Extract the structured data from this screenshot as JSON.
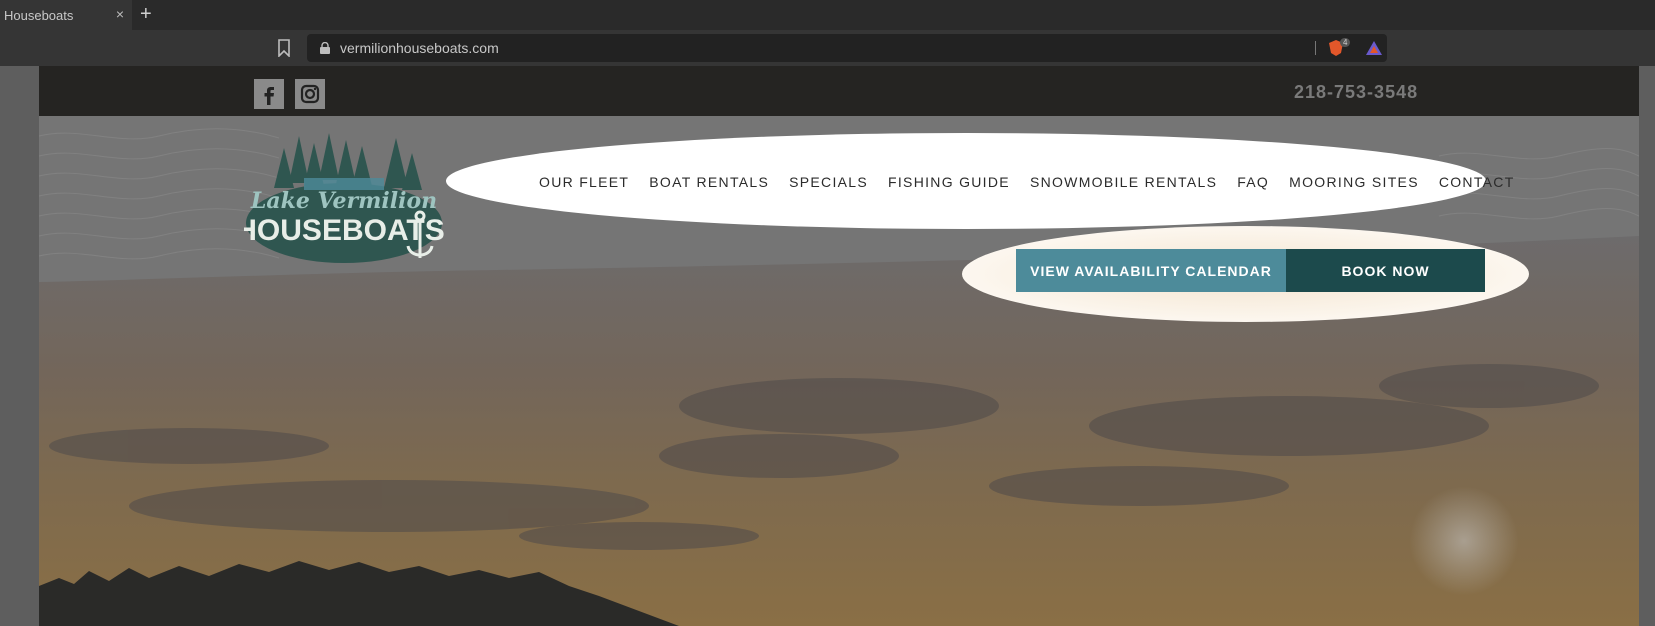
{
  "browser": {
    "tab_title": "Houseboats",
    "tab_close": "×",
    "new_tab": "+",
    "url": "vermilionhouseboats.com",
    "shield_count": "4"
  },
  "site": {
    "phone": "218-753-3548",
    "logo_text_top": "Lake Vermilion",
    "logo_text_bottom": "HOUSEBOATS",
    "nav": [
      "OUR FLEET",
      "BOAT RENTALS",
      "SPECIALS",
      "FISHING GUIDE",
      "SNOWMOBILE RENTALS",
      "FAQ",
      "MOORING SITES",
      "CONTACT"
    ],
    "cta_availability": "VIEW AVAILABILITY CALENDAR",
    "cta_book": "BOOK NOW",
    "colors": {
      "teal_light": "#4d8b9a",
      "teal_dark": "#1c4a4c",
      "topbar": "#252422"
    }
  }
}
